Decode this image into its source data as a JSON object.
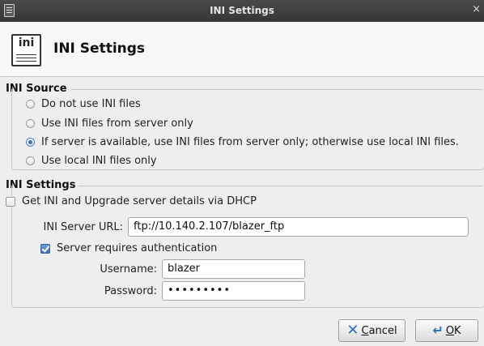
{
  "window": {
    "title": "INI Settings",
    "close_glyph": "×"
  },
  "header": {
    "icon_text": "ini",
    "title": "INI Settings"
  },
  "source": {
    "title": "INI Source",
    "options": [
      {
        "label": "Do not use INI files",
        "selected": false
      },
      {
        "label": "Use INI files from server only",
        "selected": false
      },
      {
        "label": "If server is available, use INI files from server only; otherwise use local INI files.",
        "selected": true
      },
      {
        "label": "Use local INI files only",
        "selected": false
      }
    ]
  },
  "settings": {
    "title": "INI Settings",
    "dhcp_label": "Get INI and Upgrade server details via DHCP",
    "dhcp_checked": false,
    "server_url_label": "INI Server URL:",
    "server_url_value": "ftp://10.140.2.107/blazer_ftp",
    "auth_label": "Server requires authentication",
    "auth_checked": true,
    "username_label": "Username:",
    "username_value": "blazer",
    "password_label": "Password:",
    "password_value": "•••••••••"
  },
  "buttons": {
    "cancel_mnemonic": "C",
    "cancel_rest": "ancel",
    "ok_mnemonic": "O",
    "ok_rest": "K"
  },
  "colors": {
    "accent": "#3d73b8",
    "titlebar": "#3e3e3e"
  }
}
